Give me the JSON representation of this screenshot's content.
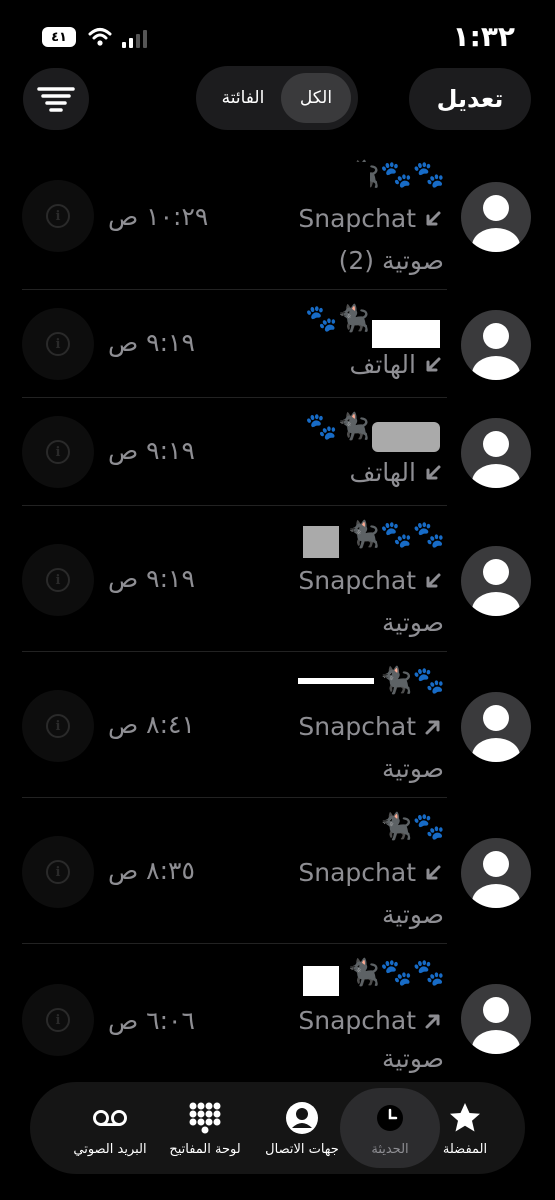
{
  "status_bar": {
    "time": "١:٣٢",
    "battery": "٤١"
  },
  "header": {
    "edit_label": "تعديل",
    "segments": {
      "all": "الكل",
      "missed": "الفائتة"
    }
  },
  "calls": [
    {
      "name": "🐈‍⬛🐾🐾",
      "type": "Snapchat",
      "direction": "incoming",
      "sub": "صوتية (2)",
      "time": "١٠:٢٩ ص"
    },
    {
      "name": "🐾🐈‍⬛",
      "type": "الهاتف",
      "direction": "incoming",
      "sub": "",
      "time": "٩:١٩ ص"
    },
    {
      "name": "🐾🐈‍⬛",
      "type": "الهاتف",
      "direction": "incoming",
      "sub": "",
      "time": "٩:١٩ ص"
    },
    {
      "name": "🐈‍⬛🐾🐾",
      "type": "Snapchat",
      "direction": "incoming",
      "sub": "صوتية",
      "time": "٩:١٩ ص"
    },
    {
      "name": "🐈‍⬛🐾",
      "type": "Snapchat",
      "direction": "outgoing",
      "sub": "صوتية",
      "time": "٨:٤١ ص"
    },
    {
      "name": "🐈‍⬛🐾",
      "type": "Snapchat",
      "direction": "incoming",
      "sub": "صوتية",
      "time": "٨:٣٥ ص"
    },
    {
      "name": "🐈‍⬛🐾🐾",
      "type": "Snapchat",
      "direction": "outgoing",
      "sub": "صوتية",
      "time": "٦:٠٦ ص"
    }
  ],
  "tabs": {
    "favorites": "المفضلة",
    "recents": "الحديثة",
    "contacts": "جهات الاتصال",
    "keypad": "لوحة المفاتيح",
    "voicemail": "البريد الصوتي"
  },
  "colors": {
    "background": "#000000",
    "secondary_text": "#8e8e93",
    "pill": "#1c1c1e",
    "active_segment": "#3a3a3c"
  }
}
